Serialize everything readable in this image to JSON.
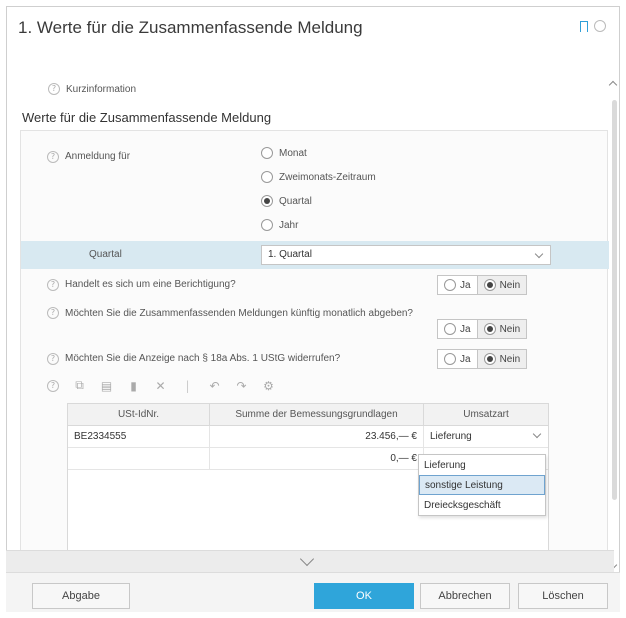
{
  "window": {
    "title": "1. Werte für die Zusammenfassende Meldung"
  },
  "kurzinfo": "Kurzinformation",
  "section": {
    "title": "Werte für die Zusammenfassende Meldung"
  },
  "anmeldung": {
    "label": "Anmeldung für",
    "options": [
      "Monat",
      "Zweimonats-Zeitraum",
      "Quartal",
      "Jahr"
    ],
    "selected": "Quartal"
  },
  "quartal": {
    "label": "Quartal",
    "value": "1. Quartal"
  },
  "questions": [
    {
      "text": "Handelt es sich um eine Berichtigung?",
      "yes": "Ja",
      "no": "Nein",
      "selected": "Nein"
    },
    {
      "text": "Möchten Sie die Zusammenfassenden Meldungen künftig monatlich abgeben?",
      "yes": "Ja",
      "no": "Nein",
      "selected": "Nein"
    },
    {
      "text": "Möchten Sie die Anzeige nach § 18a Abs. 1 UStG widerrufen?",
      "yes": "Ja",
      "no": "Nein",
      "selected": "Nein"
    }
  ],
  "toolbar": {
    "icons": [
      "copy-icon",
      "paste-icon",
      "delete-icon",
      "cut-icon",
      "undo-icon",
      "redo-icon",
      "settings-icon"
    ]
  },
  "table": {
    "columns": [
      "USt-IdNr.",
      "Summe der Bemessungsgrundlagen",
      "Umsatzart"
    ],
    "rows": [
      {
        "ustid": "BE2334555",
        "summe": "23.456,— €",
        "umsatzart": "Lieferung"
      },
      {
        "ustid": "",
        "summe": "0,— €",
        "umsatzart": ""
      }
    ]
  },
  "dropdown": {
    "options": [
      "Lieferung",
      "sonstige Leistung",
      "Dreiecksgeschäft"
    ],
    "highlighted": "sonstige Leistung"
  },
  "footer": {
    "abgabe": "Abgabe",
    "ok": "OK",
    "abbrechen": "Abbrechen",
    "loeschen": "Löschen"
  },
  "colors": {
    "accent": "#2fa5da",
    "band": "#d8e9f1",
    "highlight": "#dbe9f4"
  }
}
